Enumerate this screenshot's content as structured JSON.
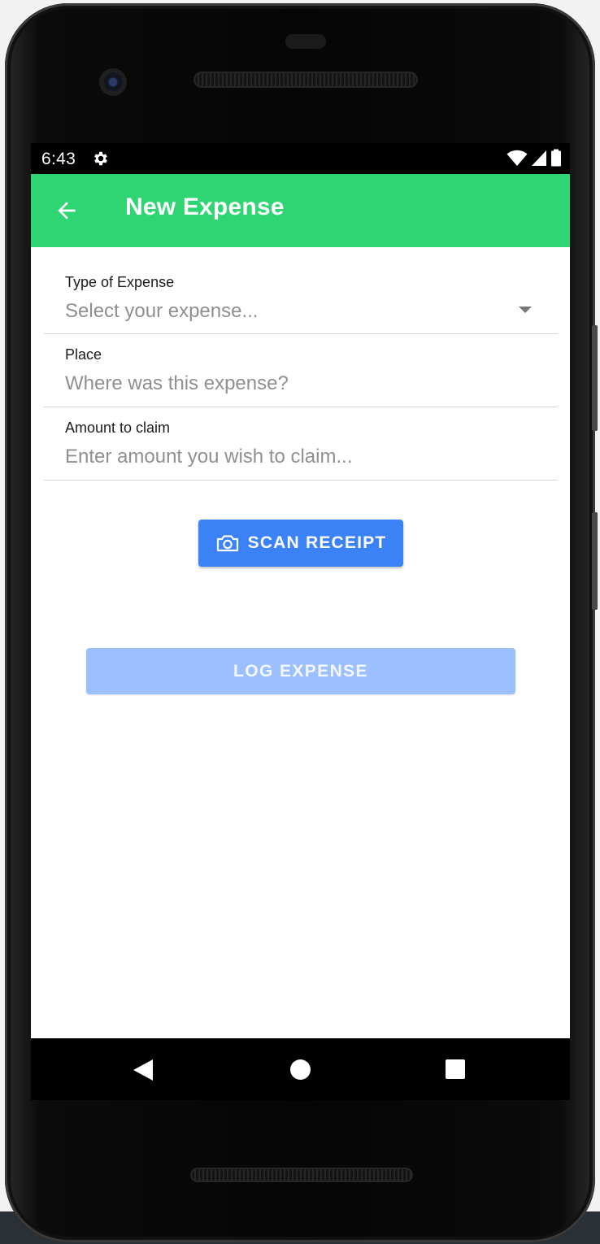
{
  "status_bar": {
    "time": "6:43",
    "icons": [
      "settings-icon",
      "wifi-icon",
      "cell-signal-icon",
      "battery-icon"
    ]
  },
  "app_bar": {
    "title": "New Expense",
    "back_icon": "back-arrow-icon",
    "color": "#2fd572"
  },
  "form": {
    "type_of_expense": {
      "label": "Type of Expense",
      "placeholder": "Select your expense...",
      "value": ""
    },
    "place": {
      "label": "Place",
      "placeholder": "Where was this expense?",
      "value": ""
    },
    "amount": {
      "label": "Amount to claim",
      "placeholder": "Enter amount you wish to claim...",
      "value": ""
    }
  },
  "actions": {
    "scan_receipt_label": "SCAN RECEIPT",
    "scan_receipt_icon": "camera-icon",
    "log_expense_label": "LOG EXPENSE",
    "primary_color": "#3b82f6",
    "disabled_color": "#9cc0ff"
  },
  "nav_bar": {
    "back_icon": "nav-back-icon",
    "home_icon": "nav-home-icon",
    "recents_icon": "nav-recents-icon"
  }
}
